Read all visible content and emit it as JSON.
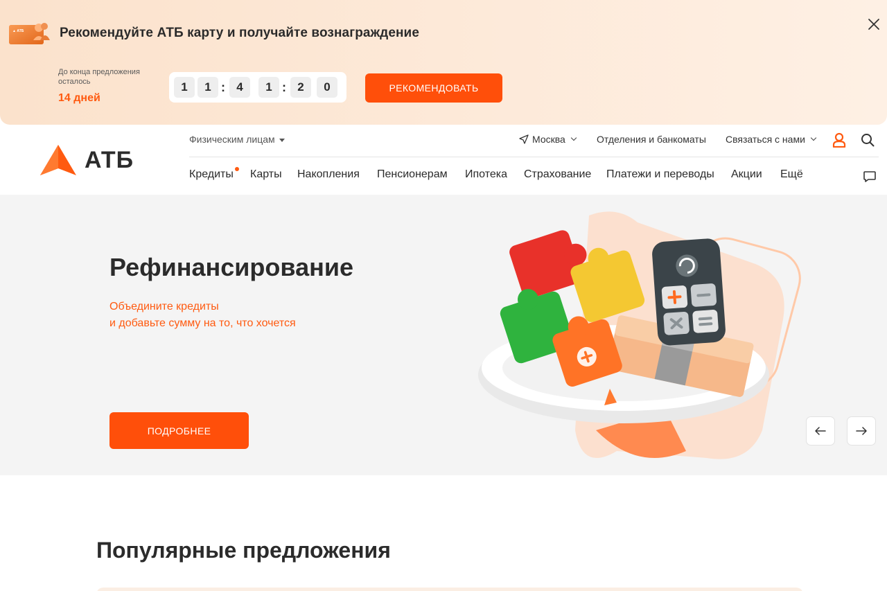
{
  "promo": {
    "title": "Рекомендуйте АТБ карту и получайте вознаграждение",
    "until_label": "До конца предложения осталось",
    "days_left": "14 дней",
    "timer_digits": [
      "1",
      "1",
      "4",
      "1",
      "2",
      "0"
    ],
    "timer_separator": ":",
    "cta": "РЕКОМЕНДОВАТЬ"
  },
  "header": {
    "logo_text": "АТБ",
    "segment": "Физическим лицам",
    "city": "Москва",
    "branches": "Отделения и банкоматы",
    "contact": "Связаться с нами",
    "nav": [
      "Кредиты",
      "Карты",
      "Накопления",
      "Пенсионерам",
      "Ипотека",
      "Страхование",
      "Платежи и переводы",
      "Акции",
      "Ещё"
    ]
  },
  "hero": {
    "title": "Рефинансирование",
    "subtitle_line1": "Объедините кредиты",
    "subtitle_line2": "и добавьте сумму на то, что хочется",
    "cta": "ПОДРОБНЕЕ"
  },
  "popular": {
    "title": "Популярные предложения"
  },
  "colors": {
    "accent": "#ff4f0a",
    "promo_bg": "#fde6d2",
    "hero_bg": "#f4f4f4"
  },
  "icons": [
    "card-icon",
    "close-icon",
    "location-arrow-icon",
    "user-icon",
    "search-icon",
    "chat-icon",
    "arrow-left-icon",
    "arrow-right-icon"
  ]
}
